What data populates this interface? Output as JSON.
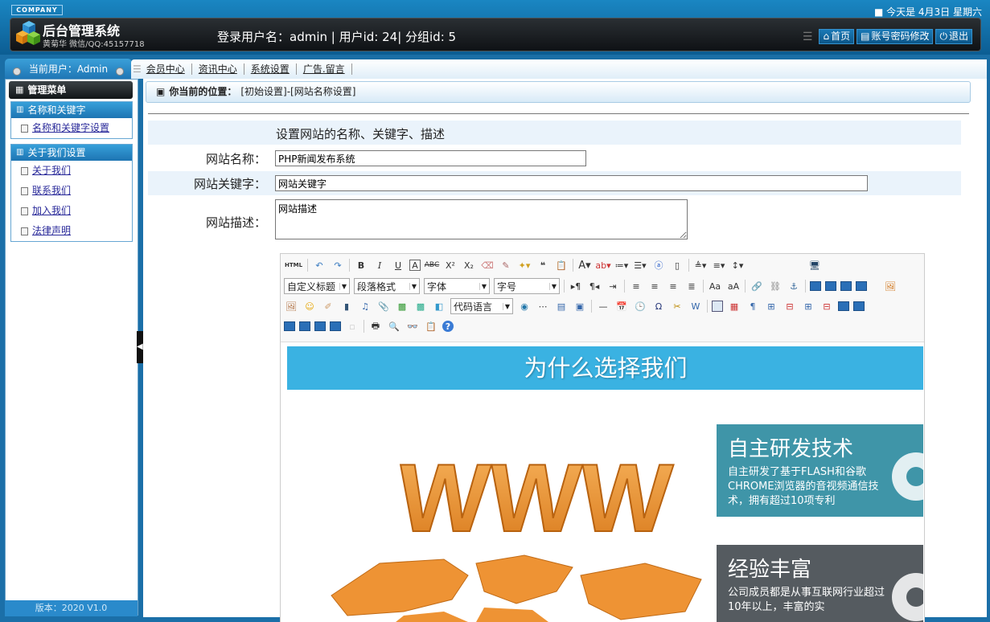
{
  "header": {
    "company_badge": "COMPANY",
    "date_text": "■ 今天是 4月3日  星期六",
    "title": "后台管理系统",
    "subtitle": "黄菊华 微信/QQ:45157718",
    "login_info": "登录用户名：admin | 用户id: 24| 分组id: 5",
    "links": [
      {
        "label": "首页",
        "icon": "home-icon"
      },
      {
        "label": "账号密码修改",
        "icon": "account-icon"
      },
      {
        "label": "退出",
        "icon": "power-icon"
      }
    ]
  },
  "nav": {
    "current_user": "当前用户：Admin",
    "items": [
      "会员中心",
      "资讯中心",
      "系统设置",
      "广告.留言"
    ]
  },
  "sidebar": {
    "menu_title": "管理菜单",
    "groups": [
      {
        "title": "名称和关键字",
        "items": [
          "名称和关键字设置"
        ]
      },
      {
        "title": "关于我们设置",
        "items": [
          "关于我们",
          "联系我们",
          "加入我们",
          "法律声明"
        ]
      }
    ],
    "version": "版本：2020 V1.0"
  },
  "breadcrumb": {
    "prefix": "你当前的位置：",
    "path": "[初始设置]-[网站名称设置]"
  },
  "form": {
    "intro": "设置网站的名称、关键字、描述",
    "site_name_label": "网站名称：",
    "site_name_value": "PHP新闻发布系统",
    "keywords_label": "网站关键字：",
    "keywords_value": "网站关键字",
    "description_label": "网站描述：",
    "description_value": "网站描述"
  },
  "editor": {
    "html_button": "HTML",
    "combos": [
      "自定义标题",
      "段落格式",
      "字体",
      "字号",
      "代码语言"
    ],
    "content": {
      "banner": "为什么选择我们",
      "card1_title": "自主研发技术",
      "card1_text": "自主研发了基于FLASH和谷歌CHROME浏览器的音视频通信技术，拥有超过10项专利",
      "card2_title": "经验丰富",
      "card2_text": "公司成员都是从事互联网行业超过10年以上，丰富的实"
    }
  },
  "colors": {
    "header_blue": "#1a86c2",
    "banner_blue": "#3ab2e2",
    "card1": "#3f95a8",
    "card2": "#555b60",
    "www_orange": "#f29a3d"
  }
}
